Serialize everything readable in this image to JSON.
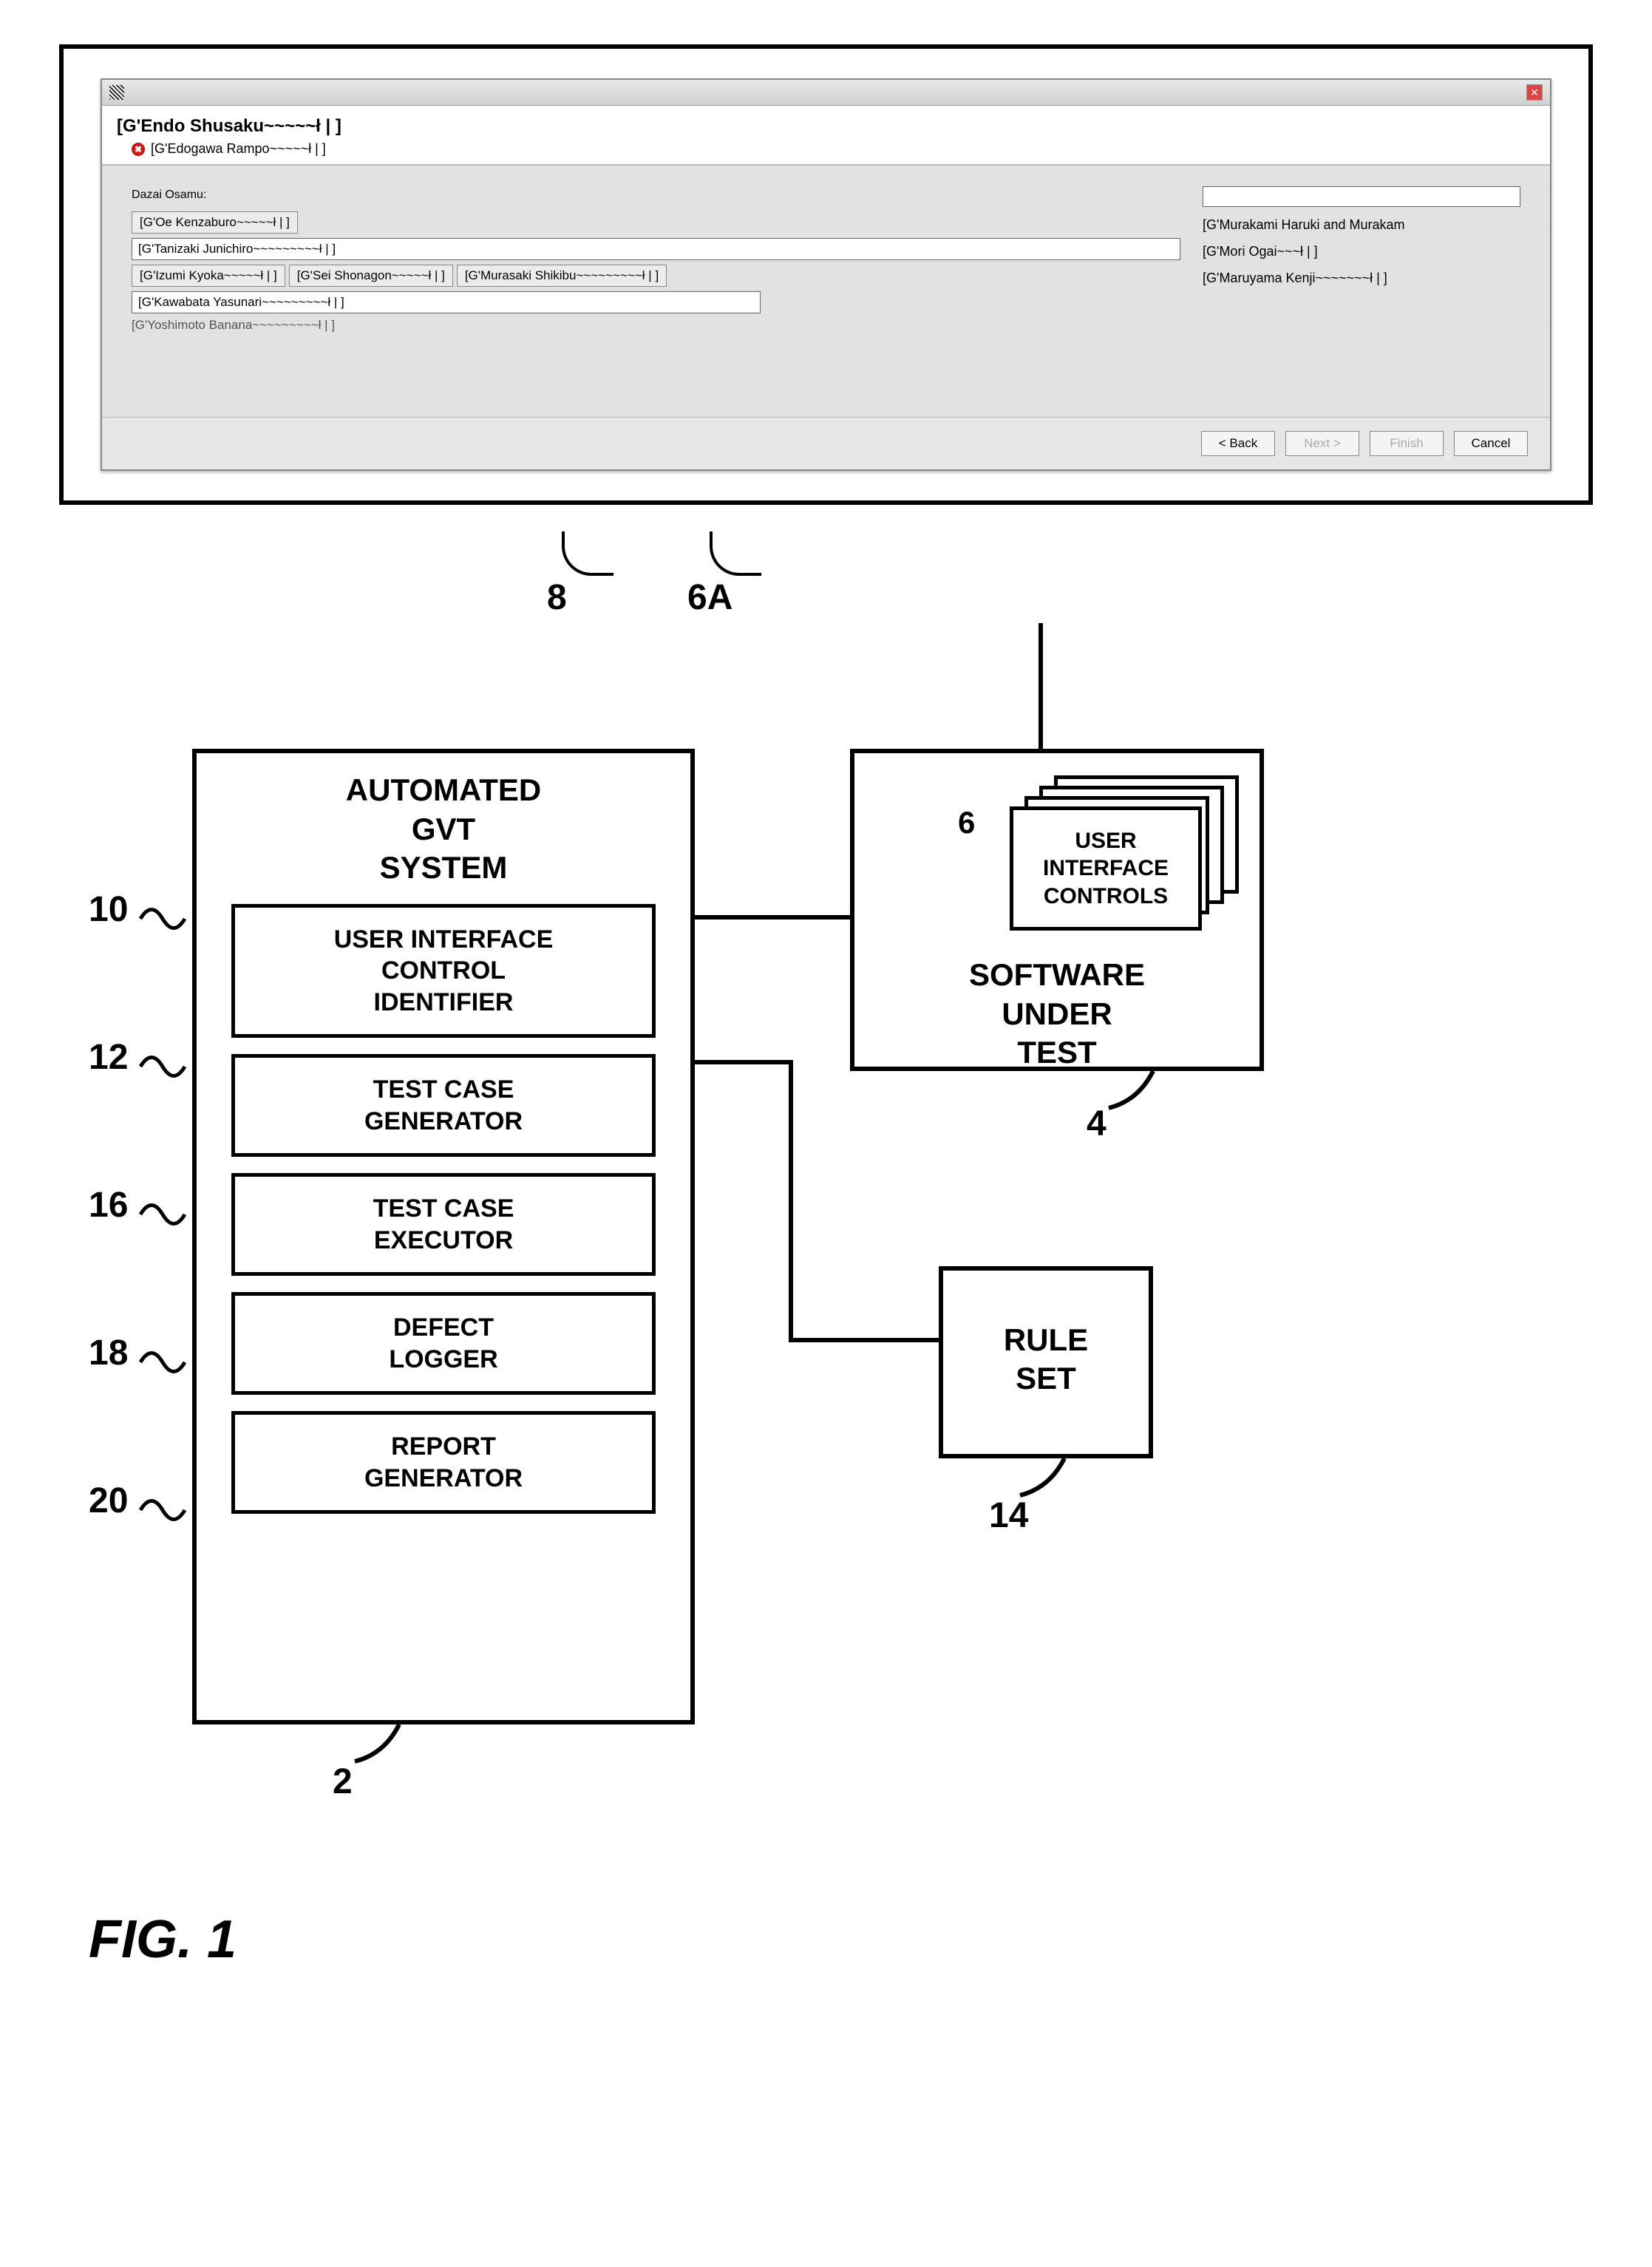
{
  "dialog": {
    "title": "[G'Endo Shusaku~~~~~ł | ]",
    "subtitle": "[G'Edogawa Rampo~~~~~ł | ]",
    "label_top": "Dazai Osamu:",
    "btn_oe": "[G'Oe Kenzaburo~~~~~ł | ]",
    "right_murakami": "[G'Murakami Haruki and Murakam",
    "field_tanizaki": "[G'Tanizaki Junichiro~~~~~~~~~ł | ]",
    "right_mori": "[G'Mori Ogai~~~ł | ]",
    "btn_izumi": "[G'Izumi Kyoka~~~~~ł | ]",
    "btn_sei": "[G'Sei Shonagon~~~~~ł | ]",
    "btn_murasaki": "[G'Murasaki Shikibu~~~~~~~~~ł | ]",
    "right_maruyama": "[G'Maruyama Kenji~~~~~~~ł | ]",
    "field_kawabata": "[G'Kawabata Yasunari~~~~~~~~~ł | ]",
    "txt_yoshimoto": "[G'Yoshimoto Banana~~~~~~~~~ł | ]",
    "buttons": {
      "back": "< Back",
      "next": "Next >",
      "finish": "Finish",
      "cancel": "Cancel"
    }
  },
  "callouts": {
    "eight": "8",
    "sixA": "6A"
  },
  "blocks": {
    "gvt_title": "AUTOMATED\nGVT\nSYSTEM",
    "ui_ident": "USER INTERFACE\nCONTROL\nIDENTIFIER",
    "tc_gen": "TEST CASE\nGENERATOR",
    "tc_exec": "TEST CASE\nEXECUTOR",
    "defect": "DEFECT\nLOGGER",
    "report": "REPORT\nGENERATOR",
    "sut_title": "SOFTWARE\nUNDER\nTEST",
    "uic": "USER\nINTERFACE\nCONTROLS",
    "rule": "RULE\nSET"
  },
  "refs": {
    "r10": "10",
    "r12": "12",
    "r16": "16",
    "r18": "18",
    "r20": "20",
    "r2": "2",
    "r6": "6",
    "r4": "4",
    "r14": "14"
  },
  "figure": "FIG. 1"
}
